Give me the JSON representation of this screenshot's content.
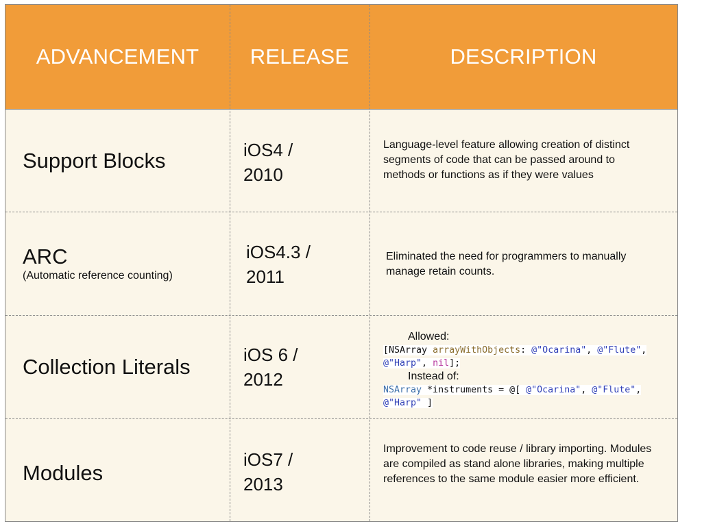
{
  "header": {
    "col1": "ADVANCEMENT",
    "col2": "RELEASE",
    "col3": "DESCRIPTION"
  },
  "rows": [
    {
      "advancement": "Support Blocks",
      "release_line1": "iOS4 /",
      "release_line2": "2010",
      "description": "Language-level feature allowing creation of distinct segments of code that can be passed around to methods or functions as if they were values"
    },
    {
      "advancement": "ARC",
      "advancement_sub": "(Automatic reference counting)",
      "release_line1": "iOS4.3 /",
      "release_line2": "2011",
      "description": "Eliminated the need for programmers to manually manage retain counts."
    },
    {
      "advancement": "Collection Literals",
      "release_line1": "iOS 6 /",
      "release_line2": "2012",
      "allowed_label": "Allowed:",
      "code1": {
        "t1": "[NSArray ",
        "t2": "arrayWithObjects",
        "t3": ": ",
        "t4": "@\"Ocarina\"",
        "t5": ", ",
        "t6": "@\"Flute\"",
        "t7": ",",
        "t8": "@\"Harp\"",
        "t9": ", ",
        "t10": "nil",
        "t11": "];"
      },
      "instead_label": "Instead of:",
      "code2": {
        "t1": "NSArray",
        "t2": " *instruments = @[ ",
        "t3": "@\"Ocarina\"",
        "t4": ", ",
        "t5": "@\"Flute\"",
        "t6": ",",
        "t7": "@\"Harp\"",
        "t8": " ]"
      }
    },
    {
      "advancement": "Modules",
      "release_line1": "iOS7 /",
      "release_line2": "2013",
      "description": "Improvement to code reuse / library importing. Modules are compiled as stand alone libraries, making multiple references to the same module easier more efficient."
    }
  ],
  "colors": {
    "header_bg": "#f19c39",
    "row_bg": "#fbf6e9"
  }
}
